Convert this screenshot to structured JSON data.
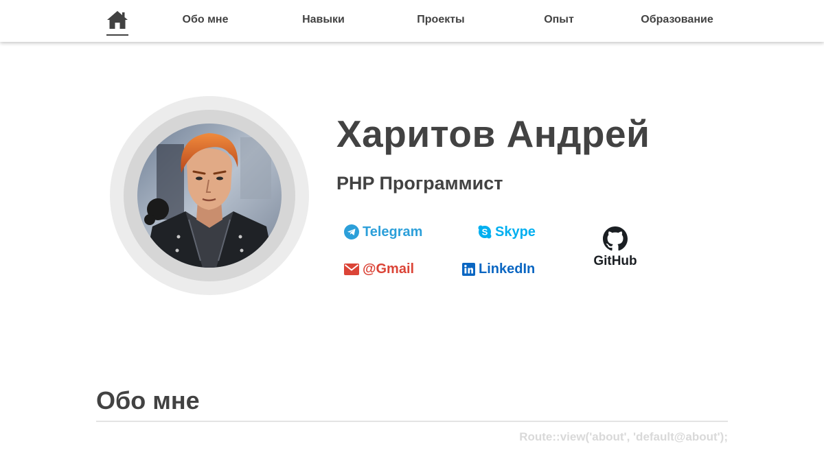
{
  "nav": {
    "home_icon": "home-icon",
    "items": [
      {
        "label": "Обо мне"
      },
      {
        "label": "Навыки"
      },
      {
        "label": "Проекты"
      },
      {
        "label": "Опыт"
      },
      {
        "label": "Образование"
      }
    ]
  },
  "profile": {
    "name": "Харитов Андрей",
    "role": "PHP Программист",
    "avatar_icon": "avatar-illustration"
  },
  "contacts": {
    "telegram": {
      "label": "Telegram",
      "icon": "telegram-icon",
      "color": "#2c9fd9"
    },
    "skype": {
      "label": "Skype",
      "icon": "skype-icon",
      "color": "#00aff0"
    },
    "gmail": {
      "label": "@Gmail",
      "icon": "envelope-icon",
      "color": "#db4437"
    },
    "linkedin": {
      "label": "LinkedIn",
      "icon": "linkedin-icon",
      "color": "#0a66c2"
    },
    "github": {
      "label": "GitHub",
      "icon": "github-icon",
      "color": "#1b1f23"
    }
  },
  "about": {
    "title": "Обо мне",
    "route_text": "Route::view('about', 'default@about');"
  },
  "colors": {
    "text": "#424242",
    "muted": "#d9d9d9",
    "ring_outer": "#ececec",
    "ring_inner": "#d6d6d6"
  }
}
